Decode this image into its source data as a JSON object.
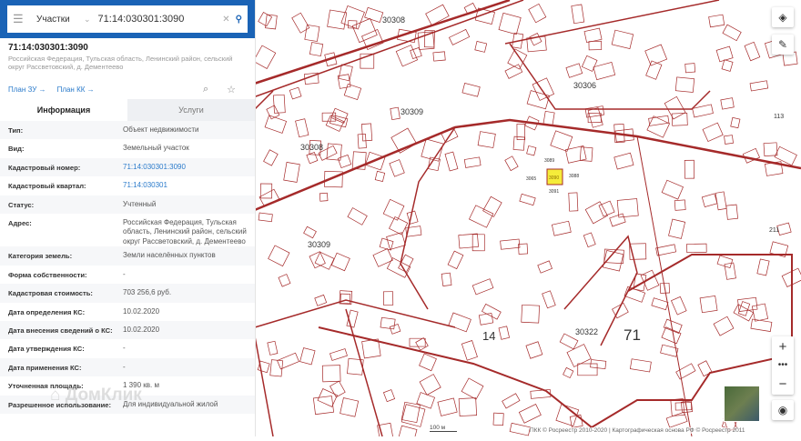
{
  "search": {
    "layer": "Участки",
    "query": "71:14:030301:3090"
  },
  "object": {
    "number": "71:14:030301:3090",
    "address": "Российская Федерация, Тульская область, Ленинский район, сельский округ Рассветовский, д. Дементеево",
    "plan_zu": "План ЗУ →",
    "plan_kk": "План КК →"
  },
  "tabs": {
    "info": "Информация",
    "services": "Услуги"
  },
  "rows": [
    {
      "k": "Тип:",
      "v": "Объект недвижимости"
    },
    {
      "k": "Вид:",
      "v": "Земельный участок"
    },
    {
      "k": "Кадастровый номер:",
      "v": "71:14:030301:3090",
      "link": true
    },
    {
      "k": "Кадастровый квартал:",
      "v": "71:14:030301",
      "link": true
    },
    {
      "k": "Статус:",
      "v": "Учтенный"
    },
    {
      "k": "Адрес:",
      "v": "Российская Федерация, Тульская область, Ленинский район, сельский округ Рассветовский, д. Дементеево"
    },
    {
      "k": "Категория земель:",
      "v": "Земли населённых пунктов"
    },
    {
      "k": "Форма собственности:",
      "v": "-"
    },
    {
      "k": "Кадастровая стоимость:",
      "v": "703 256,6 руб."
    },
    {
      "k": "Дата определения КС:",
      "v": "10.02.2020"
    },
    {
      "k": "Дата внесения сведений о КС:",
      "v": "10.02.2020"
    },
    {
      "k": "Дата утверждения КС:",
      "v": "-"
    },
    {
      "k": "Дата применения КС:",
      "v": "-"
    },
    {
      "k": "Уточненная площадь:",
      "v": "1 390 кв. м"
    },
    {
      "k": "Разрешенное использование:",
      "v": "Для индивидуальной жилой"
    }
  ],
  "map": {
    "labels": [
      "30308",
      "30306",
      "30309",
      "30308",
      "30309",
      "30322",
      "14",
      "71",
      "113",
      "211",
      "3089",
      "3088",
      "3065",
      "3091"
    ],
    "selected": "3090",
    "attribution": "ПКК © Росреестр 2010-2020 | Картографическая основа РФ © Росреестр 2011",
    "scale": "100 м",
    "colors": {
      "boundary": "#a52a2a",
      "selected": "#f5ec3a"
    }
  },
  "watermark": "ДомКлик"
}
